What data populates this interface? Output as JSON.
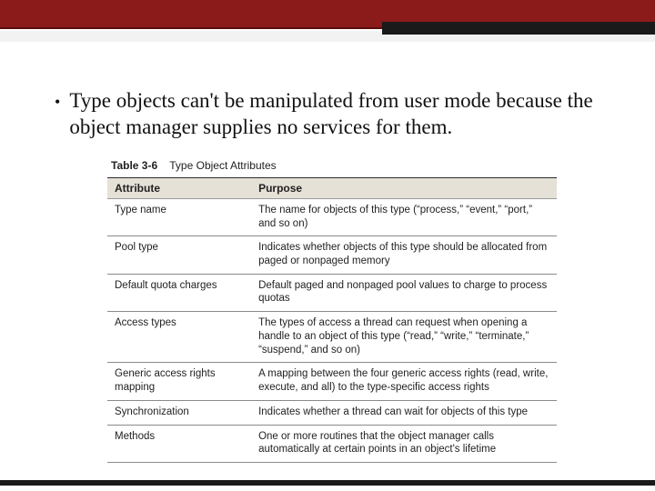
{
  "bullet_text": "Type objects can't be manipulated from user mode because the object manager supplies no services for them.",
  "table": {
    "caption_number": "Table 3-6",
    "caption_title": "Type Object Attributes",
    "headers": [
      "Attribute",
      "Purpose"
    ],
    "rows": [
      {
        "attr": "Type name",
        "purpose": "The name for objects of this type (“process,” “event,” “port,” and so on)"
      },
      {
        "attr": "Pool type",
        "purpose": "Indicates whether objects of this type should be allocated from paged or nonpaged memory"
      },
      {
        "attr": "Default quota charges",
        "purpose": "Default paged and nonpaged pool values to charge to process quotas"
      },
      {
        "attr": "Access types",
        "purpose": "The types of access a thread can request when opening a handle to an object of this type (“read,” “write,” “terminate,” “suspend,” and so on)"
      },
      {
        "attr": "Generic access rights mapping",
        "purpose": "A mapping between the four generic access rights (read, write, execute, and all) to the type-specific access rights"
      },
      {
        "attr": "Synchronization",
        "purpose": "Indicates whether a thread can wait for objects of this type"
      },
      {
        "attr": "Methods",
        "purpose": "One or more routines that the object manager calls automatically at certain points in an object's lifetime"
      }
    ]
  }
}
